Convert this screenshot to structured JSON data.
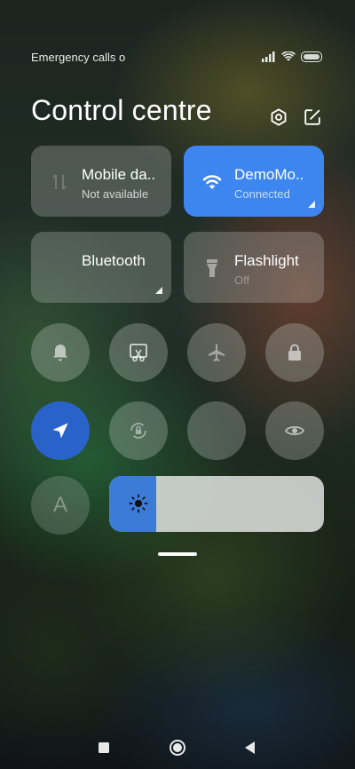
{
  "status_bar": {
    "text": "Emergency calls o",
    "icons": [
      "signal-icon",
      "wifi-icon",
      "battery-icon"
    ]
  },
  "header": {
    "title": "Control centre",
    "icons": [
      "settings-icon",
      "edit-icon"
    ]
  },
  "tiles": [
    {
      "name": "Mobile da..",
      "status": "Not available",
      "active": false,
      "icon": "mobile-data-icon"
    },
    {
      "name": "DemoMo..",
      "status": "Connected",
      "active": true,
      "icon": "wifi-icon"
    },
    {
      "name": "Bluetooth",
      "status": "",
      "active": false,
      "icon": "bluetooth-icon"
    },
    {
      "name": "Flashlight",
      "status": "Off",
      "active": false,
      "icon": "flashlight-icon"
    }
  ],
  "toggles": [
    {
      "icon": "bell-icon",
      "active": false
    },
    {
      "icon": "screenshot-icon",
      "active": false
    },
    {
      "icon": "airplane-icon",
      "active": false
    },
    {
      "icon": "lock-icon",
      "active": false
    },
    {
      "icon": "location-icon",
      "active": true
    },
    {
      "icon": "rotation-lock-icon",
      "active": false
    },
    {
      "icon": "blank-toggle",
      "active": false
    },
    {
      "icon": "eye-icon",
      "active": false
    },
    {
      "icon": "font-icon",
      "active": false
    }
  ],
  "font_toggle": {
    "label": "A"
  },
  "brightness": {
    "level": 0.22,
    "icon": "sun-icon"
  },
  "nav": {
    "buttons": [
      "recents-icon",
      "home-icon",
      "back-icon"
    ]
  },
  "colors": {
    "accent": "#3d86f0",
    "location_active": "#2962c9"
  }
}
